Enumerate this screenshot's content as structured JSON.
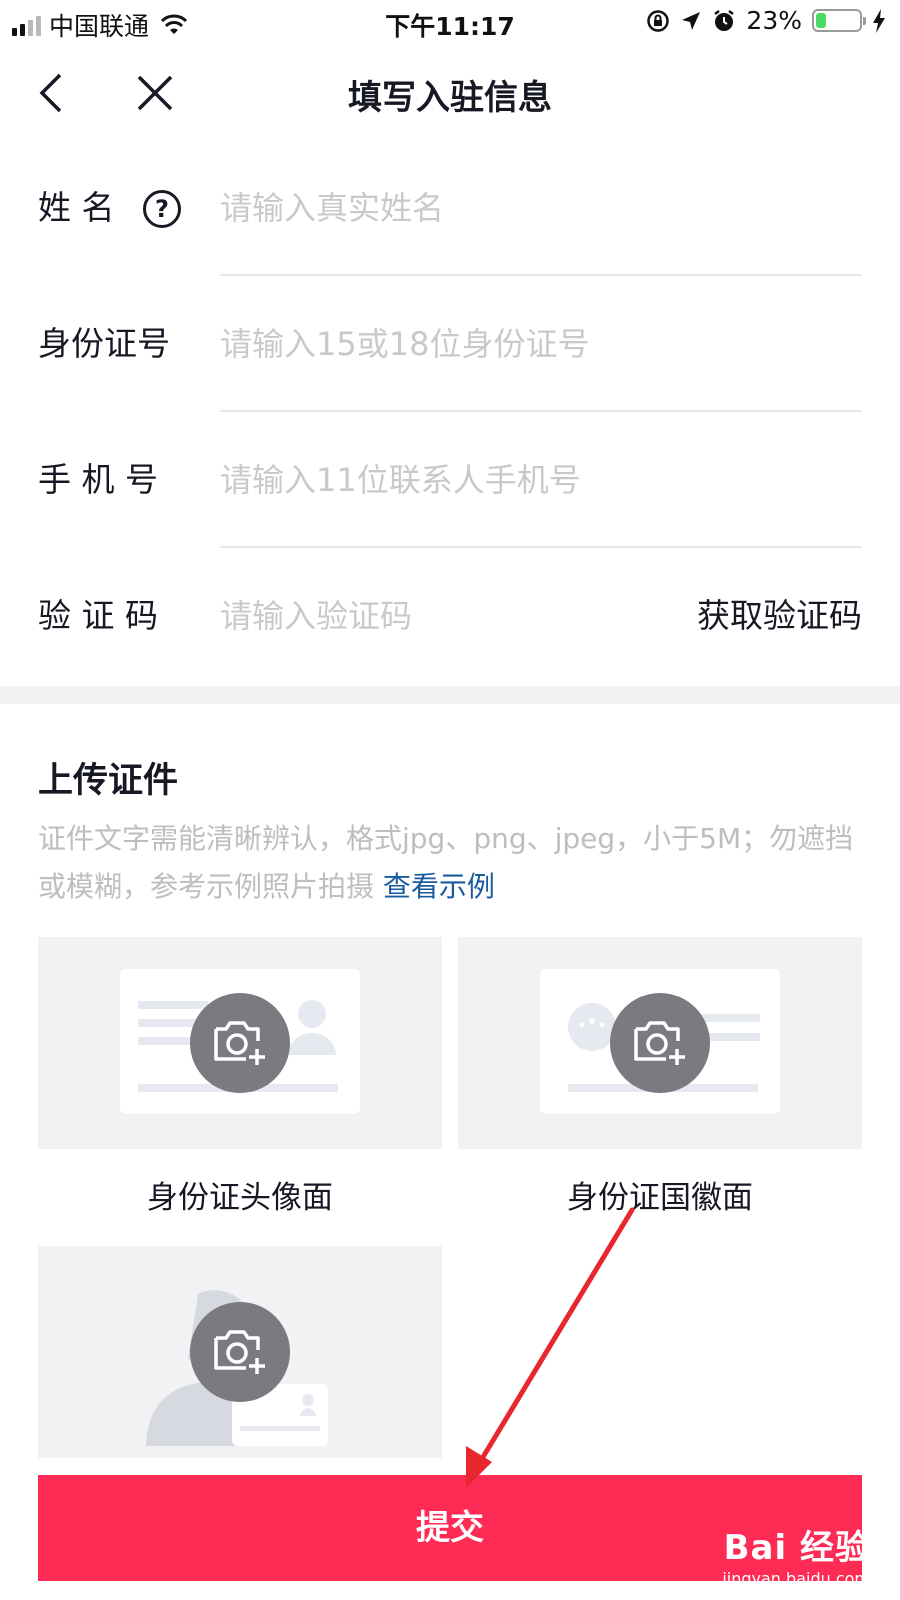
{
  "status_bar": {
    "carrier": "中国联通",
    "time": "下午11:17",
    "battery_percent": "23%",
    "battery_level": 0.23,
    "icons": [
      "signal-icon",
      "wifi-icon",
      "rotation-lock-icon",
      "location-icon",
      "alarm-icon",
      "battery-icon",
      "charging-icon"
    ]
  },
  "nav": {
    "title": "填写入驻信息",
    "back_icon": "chevron-left-icon",
    "close_icon": "close-icon"
  },
  "form": {
    "name": {
      "label": "姓 名",
      "placeholder": "请输入真实姓名",
      "help_icon": "question-icon",
      "help_glyph": "?"
    },
    "id_number": {
      "label": "身份证号",
      "placeholder": "请输入15或18位身份证号"
    },
    "phone": {
      "label": "手 机 号",
      "placeholder": "请输入11位联系人手机号"
    },
    "verify_code": {
      "label": "验 证 码",
      "placeholder": "请输入验证码",
      "get_code_label": "获取验证码"
    }
  },
  "upload": {
    "title": "上传证件",
    "description": "证件文字需能清晰辨认，格式jpg、png、jpeg，小于5M；勿遮挡或模糊，参考示例照片拍摄",
    "example_link": "查看示例",
    "cards": [
      {
        "label": "身份证头像面",
        "icon": "camera-add-icon"
      },
      {
        "label": "身份证国徽面",
        "icon": "camera-add-icon"
      },
      {
        "label": "",
        "icon": "camera-add-icon"
      }
    ]
  },
  "submit_label": "提交",
  "watermark": {
    "brand": "Bai 经验",
    "url": "jingyan.baidu.com"
  },
  "colors": {
    "accent": "#fe2c55",
    "link": "#1a5a9e",
    "placeholder": "#c9c9cc",
    "annotation_arrow": "#e8262e"
  }
}
